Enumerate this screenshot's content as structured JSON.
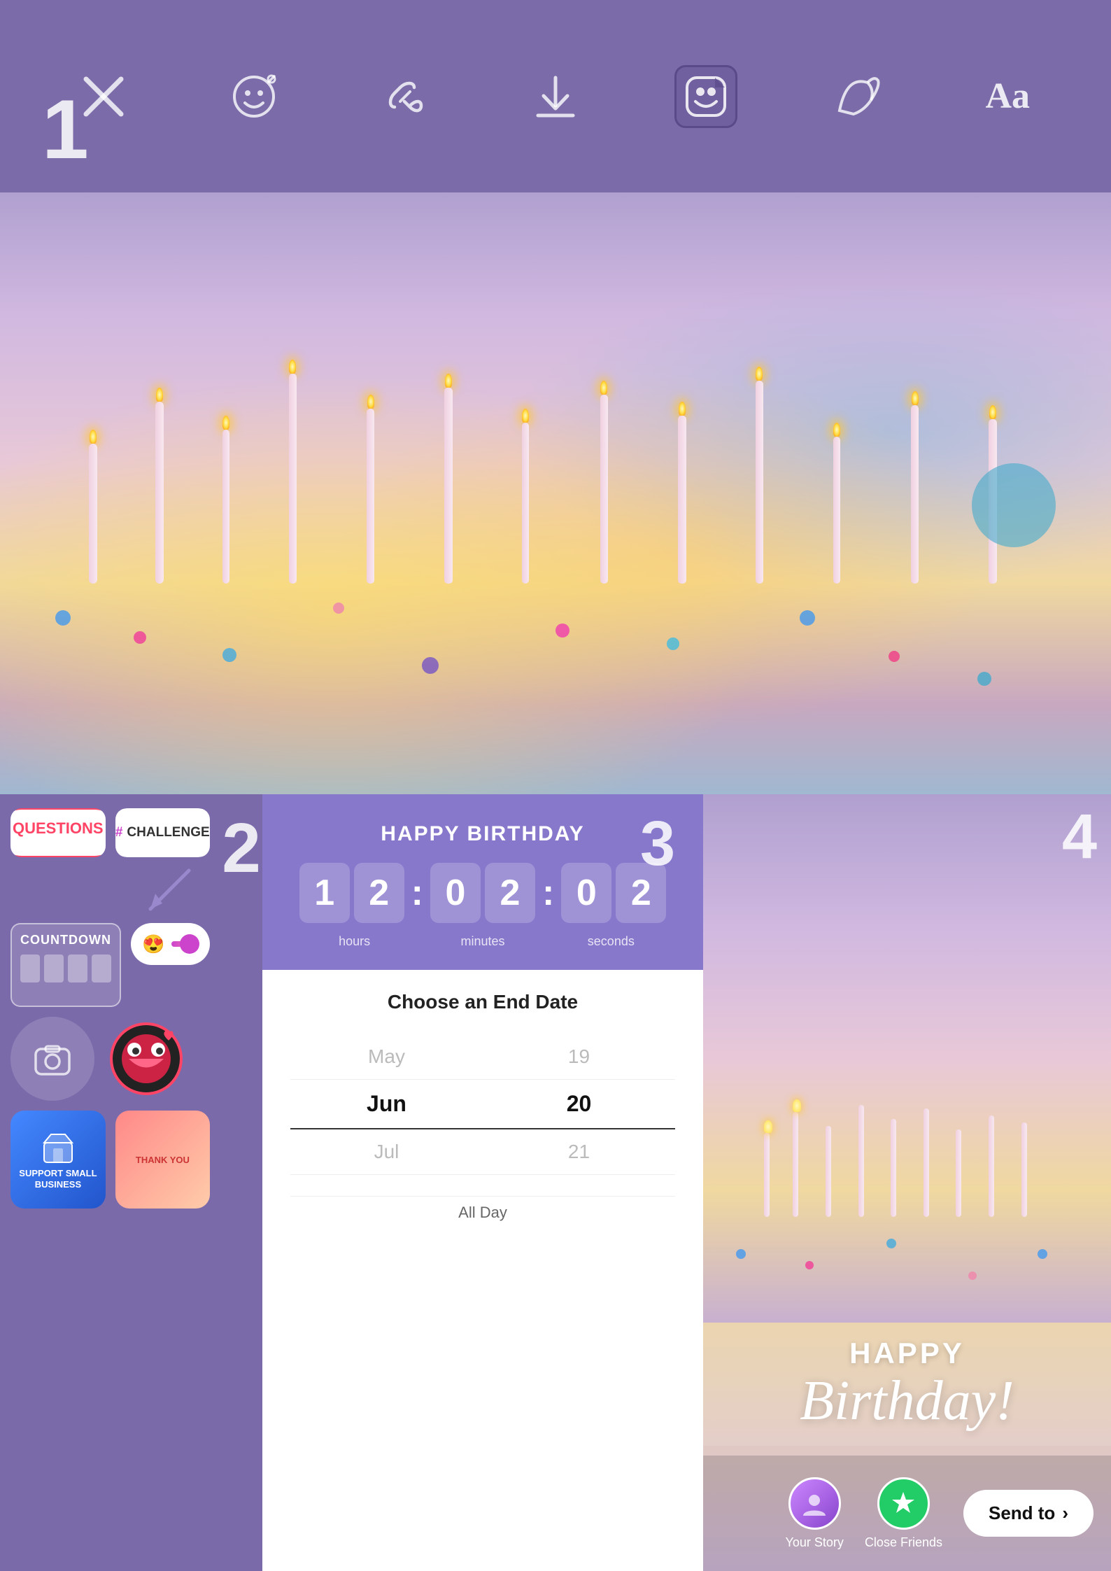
{
  "toolbar": {
    "step_number": "1",
    "close_label": "×",
    "emoji_label": "emoji-add",
    "link_label": "link",
    "download_label": "download",
    "sticker_label": "sticker-face",
    "draw_label": "draw",
    "text_label": "Aa"
  },
  "stickers": {
    "questions_label": "QUESTIONS",
    "challenge_label": "# CHALLENGE",
    "countdown_label": "COUNTDOWN",
    "support_label": "SUPPORT\nSMALL\nBUSINESS",
    "thank_you_label": "THANK YOU"
  },
  "countdown_widget": {
    "title": "HAPPY BIRTHDAY",
    "hours_1": "1",
    "hours_2": "2",
    "minutes_1": "0",
    "minutes_2": "2",
    "seconds_1": "0",
    "seconds_2": "2",
    "hours_label": "hours",
    "minutes_label": "minutes",
    "seconds_label": "seconds"
  },
  "date_picker": {
    "title": "Choose an End Date",
    "month_prev": "May",
    "month_selected": "Jun",
    "month_next": "Jul",
    "day_prev": "19",
    "day_selected": "20",
    "day_next": "21",
    "all_day_label": "All Day"
  },
  "birthday_card": {
    "happy_text": "HAPPY",
    "birthday_script": "Birthday!"
  },
  "share_bar": {
    "your_story_label": "Your Story",
    "close_friends_label": "Close Friends",
    "send_to_label": "Send to",
    "send_to_arrow": "›"
  },
  "panel_numbers": {
    "panel2_num": "2",
    "panel3_num": "3",
    "panel4_num": "4"
  }
}
